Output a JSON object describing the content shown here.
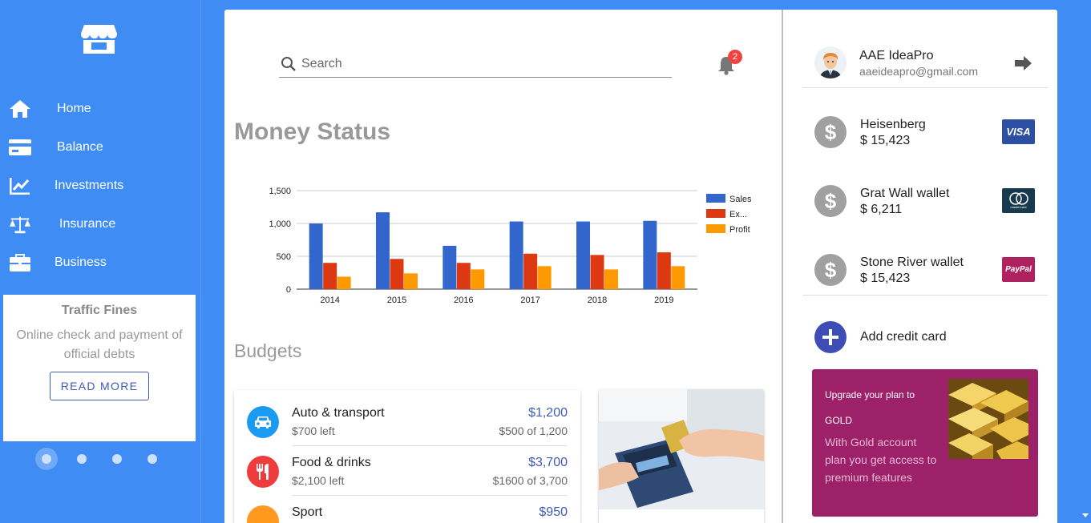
{
  "sidebar": {
    "logo_icon": "store-icon",
    "items": [
      {
        "label": "Home",
        "icon": "home-icon"
      },
      {
        "label": "Balance",
        "icon": "credit-card-icon"
      },
      {
        "label": "Investments",
        "icon": "trending-chart-icon"
      },
      {
        "label": "Insurance",
        "icon": "balance-scale-icon"
      },
      {
        "label": "Business",
        "icon": "briefcase-icon"
      }
    ],
    "promo": {
      "title": "Traffic Fines",
      "body": "Online check and payment of official debts",
      "button": "READ MORE"
    },
    "carousel": {
      "count": 4,
      "active": 1
    }
  },
  "header": {
    "search_placeholder": "Search",
    "notifications": "2"
  },
  "main": {
    "money_title": "Money Status",
    "budgets_title": "Budgets",
    "budgets": [
      {
        "name": "Auto & transport",
        "left": "$700 left",
        "amount": "$1,200",
        "of": "$500 of 1,200",
        "icon": "car-icon",
        "color": "#1a9af0"
      },
      {
        "name": "Food & drinks",
        "left": "$2,100 left",
        "amount": "$3,700",
        "of": "$1600 of 3,700",
        "icon": "fork-knife-icon",
        "color": "#ee3b3b"
      },
      {
        "name": "Sport",
        "left": "",
        "amount": "$950",
        "of": "",
        "icon": "sport-icon",
        "color": "#ff9a1f"
      }
    ]
  },
  "chart_data": {
    "type": "bar",
    "categories": [
      "2014",
      "2015",
      "2016",
      "2017",
      "2018",
      "2019"
    ],
    "series": [
      {
        "name": "Sales",
        "color": "#3366cc",
        "values": [
          1000,
          1170,
          660,
          1030,
          1030,
          1040
        ]
      },
      {
        "name": "Ex...",
        "color": "#dc3912",
        "values": [
          400,
          460,
          400,
          540,
          520,
          560
        ]
      },
      {
        "name": "Profit",
        "color": "#ff9900",
        "values": [
          190,
          240,
          300,
          350,
          300,
          350
        ]
      }
    ],
    "yticks": [
      "0",
      "500",
      "1,000",
      "1,500"
    ],
    "ylim": [
      0,
      1500
    ],
    "grid": true,
    "legend": "right"
  },
  "profile": {
    "name": "AAE IdeaPro",
    "email": "aaeideapro@gmail.com",
    "logout_icon": "logout-icon"
  },
  "wallets": [
    {
      "name": "Heisenberg",
      "amount": "$ 15,423",
      "card": "VISA",
      "card_color": "#2d4fa2"
    },
    {
      "name": "Grat Wall wallet",
      "amount": "$ 6,211",
      "card": "mastercard",
      "card_color": "#173a4e"
    },
    {
      "name": "Stone River wallet",
      "amount": "$ 15,423",
      "card": "PayPal",
      "card_color": "#b0225f"
    }
  ],
  "wallet_icon_glyph": "$",
  "add_card": {
    "label": "Add credit card"
  },
  "gold": {
    "line1": "Upgrade your plan to",
    "line2": "GOLD",
    "body": "With Gold account plan you get access to premium features"
  }
}
